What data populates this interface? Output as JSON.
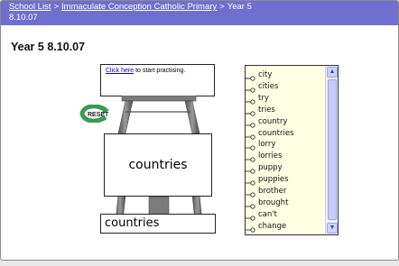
{
  "breadcrumb": {
    "school_list": "School List",
    "separator": ">",
    "school": "Immaculate Conception Catholic Primary",
    "class_name": "Year 5",
    "date": "8.10.07"
  },
  "page_title": "Year 5 8.10.07",
  "instruction": {
    "link": "Click here",
    "rest": "to start practising."
  },
  "reset_label": "RESET",
  "current_word": "countries",
  "answer_value": "countries",
  "word_list": [
    "city",
    "cities",
    "try",
    "tries",
    "country",
    "countries",
    "lorry",
    "lorries",
    "puppy",
    "puppies",
    "brother",
    "brought",
    "can't",
    "change"
  ],
  "colors": {
    "header_bar": "#6f6fd0",
    "list_background": "#ffffe4",
    "reset_arrow": "#3a9a55"
  },
  "icons": {
    "reset": "reset-arrow-icon",
    "hook": "hook-icon",
    "scroll_up": "chevron-up-icon",
    "scroll_down": "chevron-down-icon"
  }
}
